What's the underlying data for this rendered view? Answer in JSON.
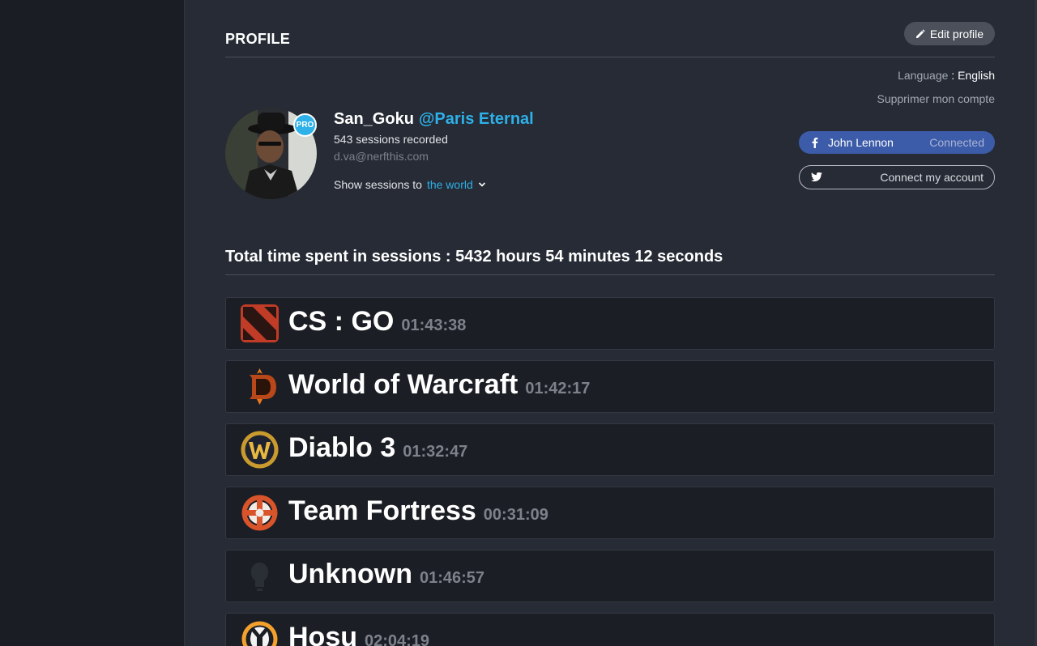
{
  "header": {
    "title": "PROFILE",
    "edit_label": "Edit profile"
  },
  "settings": {
    "language_label": "Language",
    "language_sep": " : ",
    "language_value": "English",
    "delete_label": "Supprimer mon compte"
  },
  "user": {
    "badge": "PRO",
    "username": "San_Goku",
    "team": "@Paris Eternal",
    "sessions": "543 sessions recorded",
    "email": "d.va@nerfthis.com",
    "visibility_prefix": "Show sessions to",
    "visibility_value": "the world"
  },
  "social": {
    "facebook_name": "John Lennon",
    "facebook_state": "Connected",
    "twitter_label": "Connect my account"
  },
  "summary": {
    "total": "Total time spent in sessions : 5432 hours 54 minutes 12 seconds"
  },
  "games": [
    {
      "name": "CS : GO",
      "time": "01:43:38",
      "icon": "dota-icon"
    },
    {
      "name": "World of Warcraft",
      "time": "01:42:17",
      "icon": "diablo-icon"
    },
    {
      "name": "Diablo 3",
      "time": "01:32:47",
      "icon": "warcraft-icon"
    },
    {
      "name": "Team Fortress",
      "time": "00:31:09",
      "icon": "team-fortress-icon"
    },
    {
      "name": "Unknown",
      "time": "01:46:57",
      "icon": "unknown-game-icon"
    },
    {
      "name": "Hosu",
      "time": "02:04:19",
      "icon": "overwatch-icon"
    }
  ],
  "colors": {
    "accent": "#2eb0e8",
    "facebook": "#3c5ba8",
    "background": "#262b35",
    "sidebar": "#1a1d24"
  }
}
